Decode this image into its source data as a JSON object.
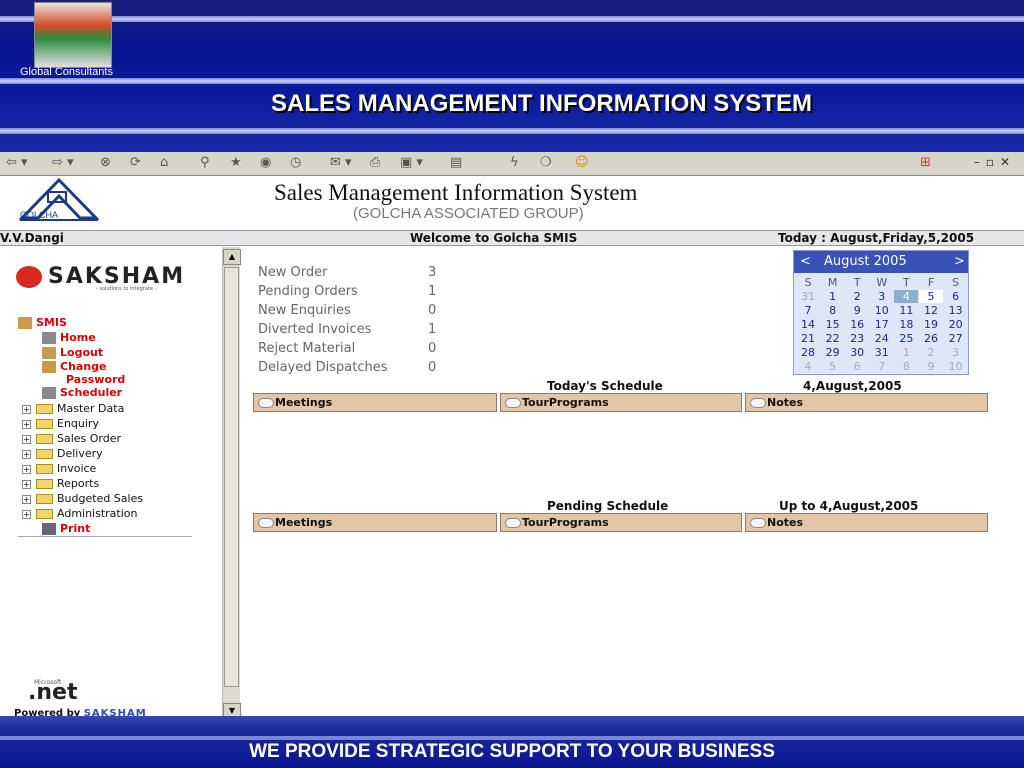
{
  "header": {
    "company": "Global Consultants",
    "title": "SALES MANAGEMENT INFORMATION SYSTEM"
  },
  "banner": {
    "logo_text": "GOLCHA",
    "title": "Sales Management Information System",
    "subtitle": "(GOLCHA ASSOCIATED GROUP)"
  },
  "infobar": {
    "user": "V.V.Dangi",
    "welcome": "Welcome to Golcha SMIS",
    "today": "Today : August,Friday,5,2005"
  },
  "sidebar": {
    "brand": "SAKSHAM",
    "brand_sub": "- solutions to integrate -",
    "root": "SMIS",
    "links": [
      {
        "label": "Home"
      },
      {
        "label": "Logout"
      },
      {
        "label": "Change"
      },
      {
        "label": "Password"
      },
      {
        "label": "Scheduler"
      }
    ],
    "folders": [
      {
        "label": "Master Data"
      },
      {
        "label": "Enquiry"
      },
      {
        "label": "Sales Order"
      },
      {
        "label": "Delivery"
      },
      {
        "label": "Invoice"
      },
      {
        "label": "Reports"
      },
      {
        "label": "Budgeted Sales"
      },
      {
        "label": "Administration"
      }
    ],
    "print": "Print",
    "ms_label": "Microsoft",
    "dotnet": ".net",
    "powered_by": "Powered by",
    "powered_name": "SAKSHAM"
  },
  "stats": [
    {
      "label": "New Order",
      "value": "3"
    },
    {
      "label": "Pending Orders",
      "value": "1"
    },
    {
      "label": "New Enquiries",
      "value": "0"
    },
    {
      "label": "Diverted Invoices",
      "value": "1"
    },
    {
      "label": "Reject Material",
      "value": "0"
    },
    {
      "label": "Delayed Dispatches",
      "value": "0"
    }
  ],
  "calendar": {
    "prev": "<",
    "next": ">",
    "month": "August 2005",
    "days": [
      "S",
      "M",
      "T",
      "W",
      "T",
      "F",
      "S"
    ],
    "weeks": [
      [
        "31",
        "1",
        "2",
        "3",
        "4",
        "5",
        "6"
      ],
      [
        "7",
        "8",
        "9",
        "10",
        "11",
        "12",
        "13"
      ],
      [
        "14",
        "15",
        "16",
        "17",
        "18",
        "19",
        "20"
      ],
      [
        "21",
        "22",
        "23",
        "24",
        "25",
        "26",
        "27"
      ],
      [
        "28",
        "29",
        "30",
        "31",
        "1",
        "2",
        "3"
      ],
      [
        "4",
        "5",
        "6",
        "7",
        "8",
        "9",
        "10"
      ]
    ],
    "selected": "4",
    "today": "5"
  },
  "today_schedule": {
    "title": "Today's Schedule",
    "date": "4,August,2005",
    "items": [
      "Meetings",
      "TourPrograms",
      "Notes"
    ]
  },
  "pending_schedule": {
    "title": "Pending Schedule",
    "date": "Up to 4,August,2005",
    "items": [
      "Meetings",
      "TourPrograms",
      "Notes"
    ]
  },
  "footer": {
    "text": "WE PROVIDE STRATEGIC SUPPORT TO YOUR BUSINESS"
  },
  "colors": {
    "header_blue": "#0b1590",
    "calendar_head": "#3a52b8",
    "schedule_box": "#e2c6a6",
    "link_red": "#d80000"
  }
}
